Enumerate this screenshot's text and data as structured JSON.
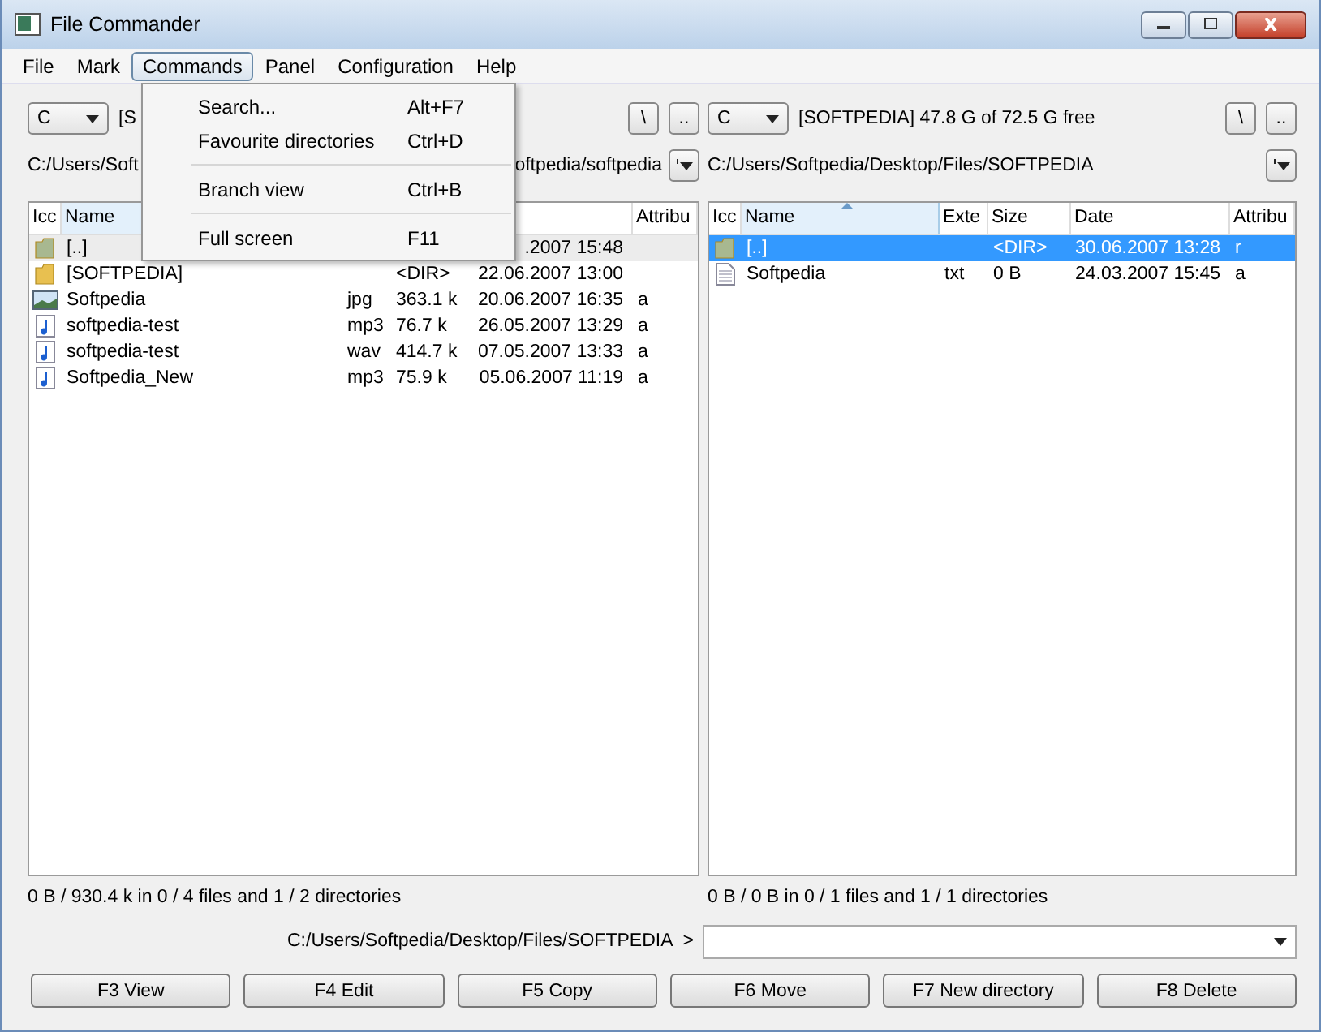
{
  "window": {
    "title": "File Commander"
  },
  "menu_bar": [
    {
      "label": "File",
      "selected": false
    },
    {
      "label": "Mark",
      "selected": false
    },
    {
      "label": "Commands",
      "selected": true
    },
    {
      "label": "Panel",
      "selected": false
    },
    {
      "label": "Configuration",
      "selected": false
    },
    {
      "label": "Help",
      "selected": false
    }
  ],
  "open_menu": [
    {
      "kind": "item",
      "label": "Search...",
      "shortcut": "Alt+F7"
    },
    {
      "kind": "item",
      "label": "Favourite directories",
      "shortcut": "Ctrl+D"
    },
    {
      "kind": "separator"
    },
    {
      "kind": "item",
      "label": "Branch view",
      "shortcut": "Ctrl+B"
    },
    {
      "kind": "separator"
    },
    {
      "kind": "item",
      "label": "Full screen",
      "shortcut": "F11"
    }
  ],
  "panels": [
    {
      "active": false,
      "drive": "C",
      "drive_info": "[S",
      "root_button": "\\",
      "up_button": "..",
      "path": "C:/Users/Soft",
      "path_tail": "oftpedia/softpedia",
      "columns": [
        {
          "label": "Icc"
        },
        {
          "label": "Name",
          "sorted": true
        },
        null,
        null,
        null,
        {
          "label": "Attribu"
        }
      ],
      "rows": [
        {
          "kind": "up",
          "name": "[..]",
          "date": ".2007 15:48",
          "selected": true
        },
        {
          "kind": "folder",
          "name": "[SOFTPEDIA]",
          "size": "<DIR>",
          "date": "22.06.2007 13:00",
          "selected": false
        },
        {
          "kind": "image",
          "name": "Softpedia",
          "ext": "jpg",
          "size": "363.1 k",
          "date": "20.06.2007 16:35",
          "attr": "a",
          "selected": false
        },
        {
          "kind": "audio",
          "name": "softpedia-test",
          "ext": "mp3",
          "size": "76.7 k",
          "date": "26.05.2007 13:29",
          "attr": "a",
          "selected": false
        },
        {
          "kind": "audio",
          "name": "softpedia-test",
          "ext": "wav",
          "size": "414.7 k",
          "date": "07.05.2007 13:33",
          "attr": "a",
          "selected": false
        },
        {
          "kind": "audio",
          "name": "Softpedia_New",
          "ext": "mp3",
          "size": "75.9 k",
          "date": "05.06.2007 11:19",
          "attr": "a",
          "selected": false
        }
      ],
      "status": "0 B / 930.4 k in 0 / 4 files and 1 / 2 directories"
    },
    {
      "active": true,
      "drive": "C",
      "drive_info": "[SOFTPEDIA] 47.8 G of 72.5 G free",
      "root_button": "\\",
      "up_button": "..",
      "path": "C:/Users/Softpedia/Desktop/Files/SOFTPEDIA",
      "columns": [
        {
          "label": "Icc"
        },
        {
          "label": "Name",
          "sorted": true,
          "sort_arrow": true
        },
        {
          "label": "Exte"
        },
        {
          "label": "Size"
        },
        {
          "label": "Date"
        },
        {
          "label": "Attribu"
        }
      ],
      "rows": [
        {
          "kind": "up",
          "name": "[..]",
          "size": "<DIR>",
          "date": "30.06.2007 13:28",
          "attr": "r",
          "selected": true
        },
        {
          "kind": "text",
          "name": "Softpedia",
          "ext": "txt",
          "size": "0 B",
          "date": "24.03.2007 15:45",
          "attr": "a",
          "selected": false
        }
      ],
      "status": "0 B / 0 B in 0 / 1 files and 1 / 1 directories"
    }
  ],
  "command_line": {
    "path": "C:/Users/Softpedia/Desktop/Files/SOFTPEDIA",
    "prompt": ">"
  },
  "function_keys": [
    "F3 View",
    "F4 Edit",
    "F5 Copy",
    "F6 Move",
    "F7 New directory",
    "F8 Delete"
  ]
}
